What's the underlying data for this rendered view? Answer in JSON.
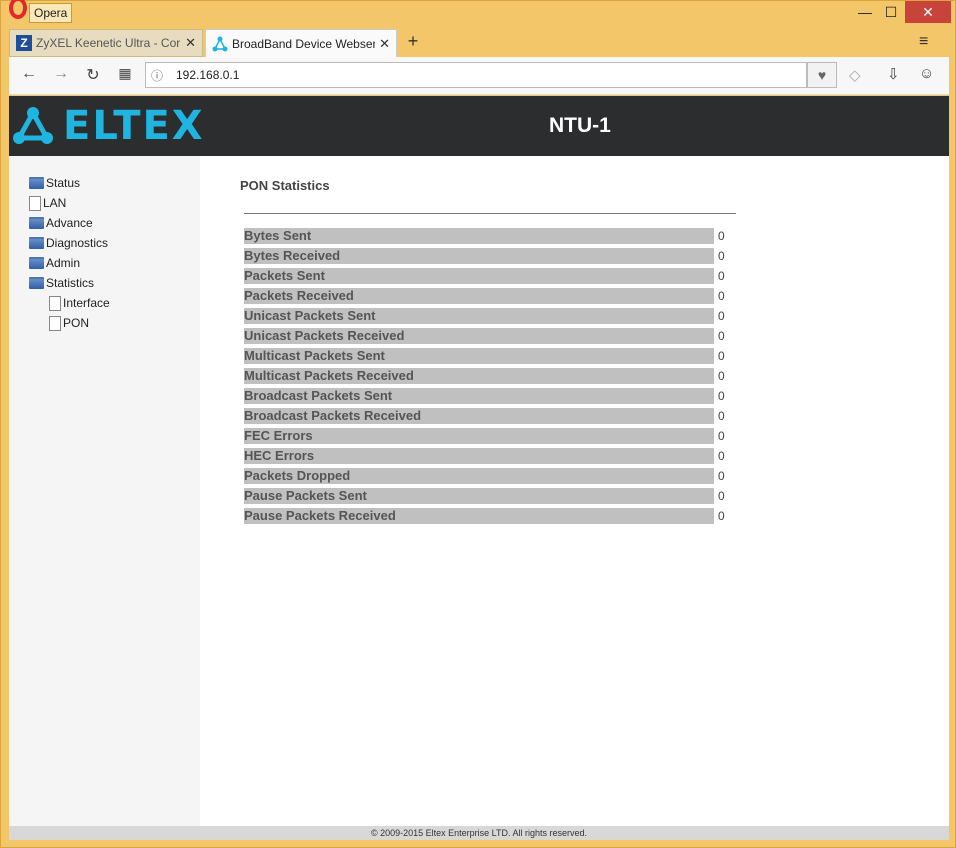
{
  "window": {
    "app_name": "Opera",
    "minimize": "—",
    "maximize": "☐",
    "close": "✕"
  },
  "tabs": [
    {
      "title": "ZyXEL Keenetic Ultra - Cor",
      "icon": "zyxel-icon",
      "close": "✕"
    },
    {
      "title": "BroadBand Device Webser",
      "icon": "eltex-icon",
      "close": "✕"
    }
  ],
  "tab_controls": {
    "new_tab": "+",
    "menu": "≡"
  },
  "toolbar": {
    "back": "←",
    "forward": "→",
    "reload": "↻",
    "speed_dial": "▦",
    "site_info": "ⓘ",
    "url": "192.168.0.1",
    "heart": "♥",
    "shield": "◇",
    "download": "⇩",
    "account": "☺"
  },
  "header": {
    "logo_text": "ELTEX",
    "model": "NTU-1",
    "colors": {
      "brand": "#1fb5e0",
      "header_bg": "#2b2d2e"
    }
  },
  "sidebar": {
    "items": [
      {
        "label": "Status",
        "icon": "folder-icon"
      },
      {
        "label": "LAN",
        "icon": "document-icon"
      },
      {
        "label": "Advance",
        "icon": "folder-icon"
      },
      {
        "label": "Diagnostics",
        "icon": "folder-icon"
      },
      {
        "label": "Admin",
        "icon": "folder-icon"
      },
      {
        "label": "Statistics",
        "icon": "folder-icon"
      },
      {
        "label": "Interface",
        "icon": "document-icon"
      },
      {
        "label": "PON",
        "icon": "document-icon"
      }
    ]
  },
  "main": {
    "title": "PON Statistics",
    "stats": [
      {
        "label": "Bytes Sent",
        "value": "0"
      },
      {
        "label": "Bytes Received",
        "value": "0"
      },
      {
        "label": "Packets Sent",
        "value": "0"
      },
      {
        "label": "Packets Received",
        "value": "0"
      },
      {
        "label": "Unicast Packets Sent",
        "value": "0"
      },
      {
        "label": "Unicast Packets Received",
        "value": "0"
      },
      {
        "label": "Multicast Packets Sent",
        "value": "0"
      },
      {
        "label": "Multicast Packets Received",
        "value": "0"
      },
      {
        "label": "Broadcast Packets Sent",
        "value": "0"
      },
      {
        "label": "Broadcast Packets Received",
        "value": "0"
      },
      {
        "label": "FEC Errors",
        "value": "0"
      },
      {
        "label": "HEC Errors",
        "value": "0"
      },
      {
        "label": "Packets Dropped",
        "value": "0"
      },
      {
        "label": "Pause Packets Sent",
        "value": "0"
      },
      {
        "label": "Pause Packets Received",
        "value": "0"
      }
    ]
  },
  "footer": {
    "text": "© 2009-2015 Eltex Enterprise LTD. All rights reserved."
  }
}
